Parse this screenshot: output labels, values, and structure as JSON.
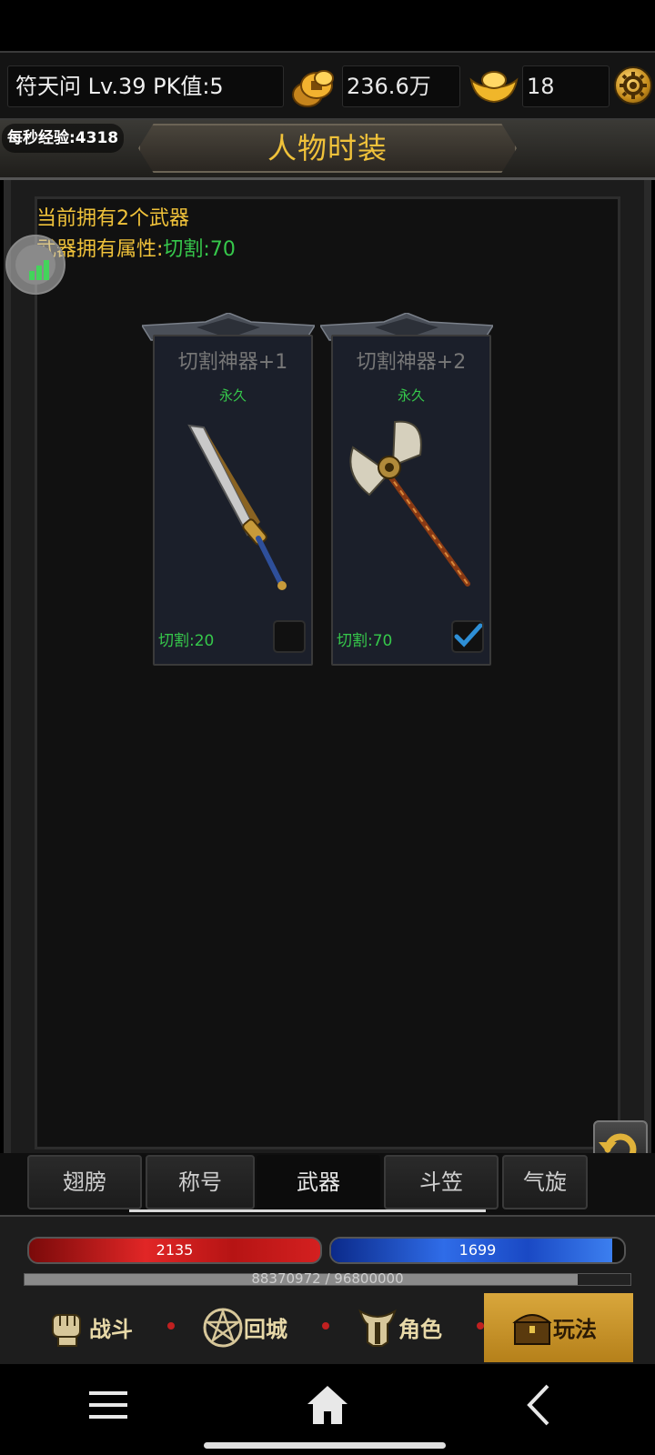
{
  "topbar": {
    "player_info": "符天问  Lv.39 PK值:5",
    "gold": "236.6万",
    "ingots": "18"
  },
  "title_bar": {
    "exp_per_second": "每秒经验:4318",
    "title": "人物时装"
  },
  "info": {
    "owned_line": "当前拥有2个武器",
    "attr_label": "武器拥有属性:",
    "attr_value": "切割:70"
  },
  "cards": [
    {
      "name": "切割神器+1",
      "duration": "永久",
      "stat": "切割:20",
      "selected": false,
      "icon": "sword-icon"
    },
    {
      "name": "切割神器+2",
      "duration": "永久",
      "stat": "切割:70",
      "selected": true,
      "icon": "axe-icon"
    }
  ],
  "tabs": [
    {
      "label": "翅膀",
      "active": false
    },
    {
      "label": "称号",
      "active": false
    },
    {
      "label": "武器",
      "active": true
    },
    {
      "label": "斗笠",
      "active": false
    },
    {
      "label": "气旋",
      "active": false
    }
  ],
  "bars": {
    "hp": "2135",
    "mp": "1699",
    "mp_fill": 0.96,
    "exp_text": "88370972 / 96800000",
    "exp_fill": 0.9129
  },
  "hud_buttons": [
    {
      "label": "战斗",
      "icon": "fist-icon",
      "active": false
    },
    {
      "label": "回城",
      "icon": "pentagram-icon",
      "active": false
    },
    {
      "label": "角色",
      "icon": "helmet-icon",
      "active": false
    },
    {
      "label": "玩法",
      "icon": "treasure-chest-icon",
      "active": true
    }
  ],
  "colors": {
    "accent_gold": "#f0c23a",
    "stat_green": "#36c84b",
    "hp_red": "#e12626",
    "mp_blue": "#2f6ce8"
  },
  "system_nav": {
    "icons": [
      "menu-icon",
      "home-icon",
      "back-icon"
    ]
  }
}
